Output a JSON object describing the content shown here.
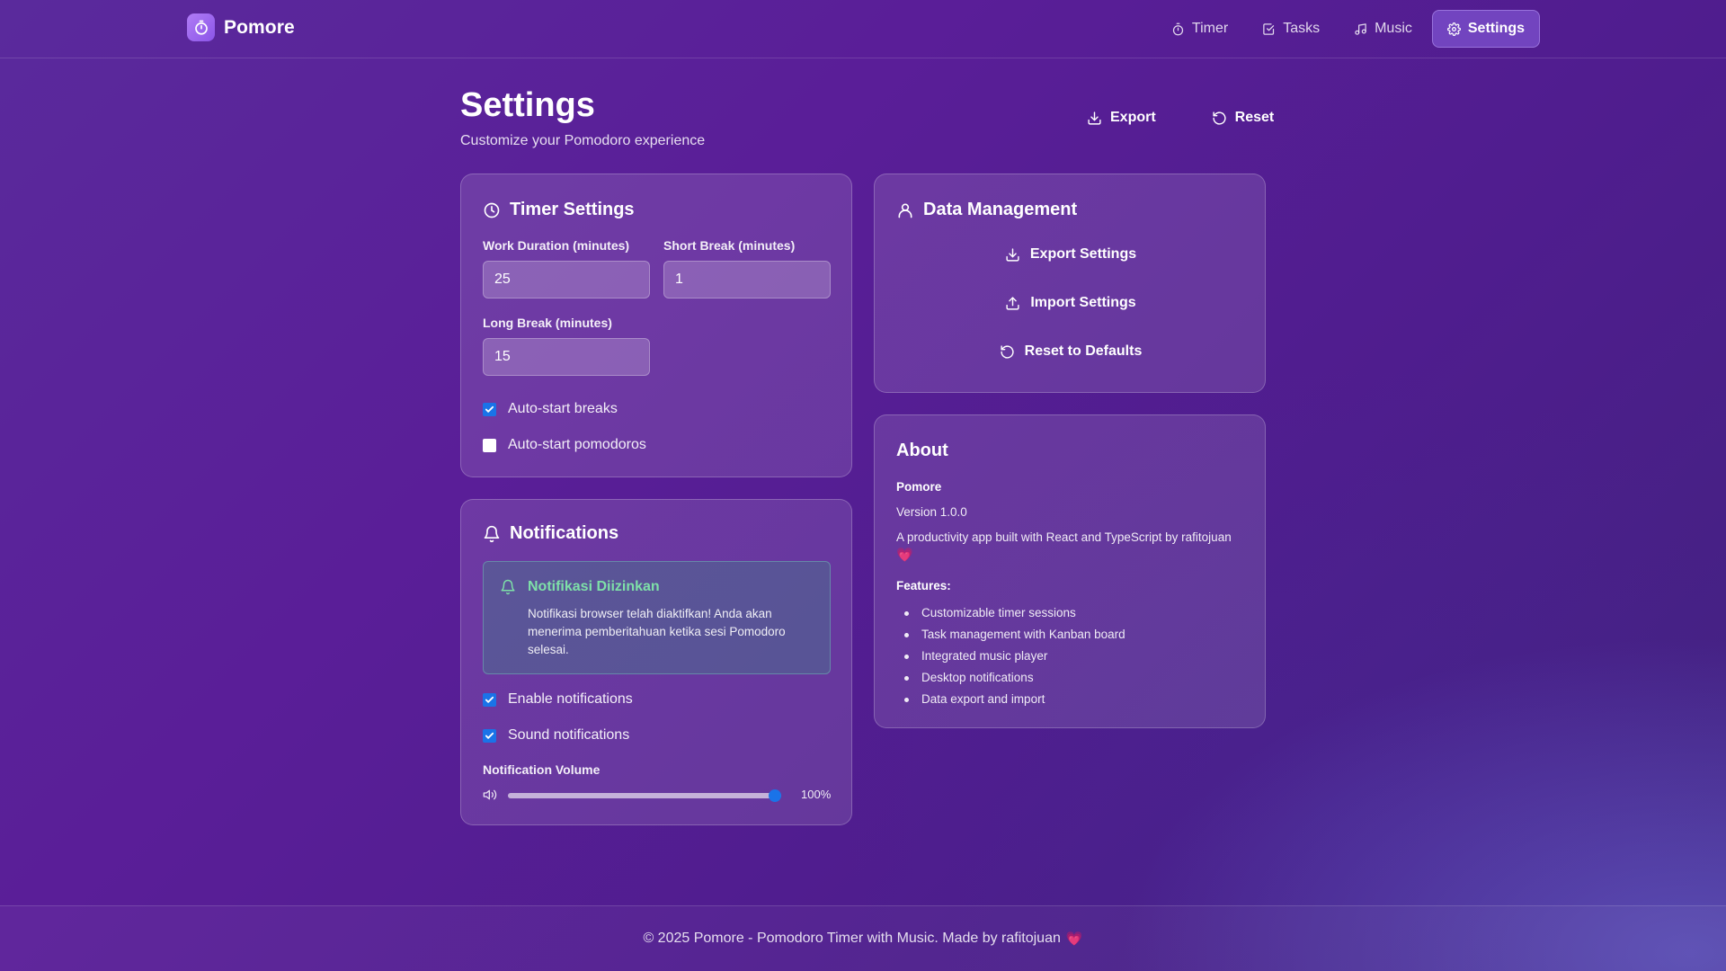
{
  "brand": {
    "name": "Pomore"
  },
  "nav": {
    "items": [
      {
        "label": "Timer",
        "icon": "stopwatch-icon",
        "active": false
      },
      {
        "label": "Tasks",
        "icon": "checkbox-icon",
        "active": false
      },
      {
        "label": "Music",
        "icon": "music-note-icon",
        "active": false
      },
      {
        "label": "Settings",
        "icon": "gear-icon",
        "active": true
      }
    ]
  },
  "page": {
    "title": "Settings",
    "subtitle": "Customize your Pomodoro experience",
    "export_label": "Export",
    "reset_label": "Reset"
  },
  "timer_settings": {
    "title": "Timer Settings",
    "work_label": "Work Duration (minutes)",
    "work_value": "25",
    "short_label": "Short Break (minutes)",
    "short_value": "1",
    "long_label": "Long Break (minutes)",
    "long_value": "15",
    "auto_breaks_label": "Auto-start breaks",
    "auto_breaks_checked": true,
    "auto_pomodoros_label": "Auto-start pomodoros",
    "auto_pomodoros_checked": false
  },
  "notifications": {
    "title": "Notifications",
    "banner_title": "Notifikasi Diizinkan",
    "banner_text": "Notifikasi browser telah diaktifkan! Anda akan menerima pemberitahuan ketika sesi Pomodoro selesai.",
    "enable_label": "Enable notifications",
    "enable_checked": true,
    "sound_label": "Sound notifications",
    "sound_checked": true,
    "volume_label": "Notification Volume",
    "volume_value": 1.0,
    "volume_text": "100%"
  },
  "data_management": {
    "title": "Data Management",
    "export_label": "Export Settings",
    "import_label": "Import Settings",
    "reset_label": "Reset to Defaults"
  },
  "about": {
    "title": "About",
    "app_name": "Pomore",
    "version": "Version 1.0.0",
    "description": "A productivity app built with React and TypeScript by rafitojuan",
    "features_title": "Features:",
    "features": [
      "Customizable timer sessions",
      "Task management with Kanban board",
      "Integrated music player",
      "Desktop notifications",
      "Data export and import"
    ]
  },
  "footer": {
    "text": "© 2025 Pomore - Pomodoro Timer with Music. Made by rafitojuan"
  },
  "colors": {
    "accent": "#1a73e8",
    "success": "#7ee0a8",
    "heart": "#f06aa6"
  }
}
